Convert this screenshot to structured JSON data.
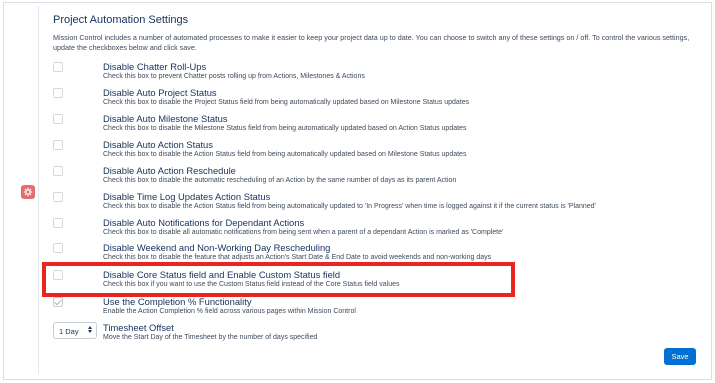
{
  "panel": {
    "title": "Project Automation Settings",
    "intro": "Mission Control includes a number of automated processes to make it easier to keep your project data up to date. You can choose to switch any of these settings on / off. To control the various settings, update the checkboxes below and click save."
  },
  "settings": [
    {
      "label": "Disable Chatter Roll-Ups",
      "desc": "Check this box to prevent Chatter posts rolling up from Actions, Milestones & Actions",
      "checked": false
    },
    {
      "label": "Disable Auto Project Status",
      "desc": "Check this box to disable the Project Status field from being automatically updated based on Milestone Status updates",
      "checked": false
    },
    {
      "label": "Disable Auto Milestone Status",
      "desc": "Check this box to disable the Milestone Status field from being automatically updated based on Action Status updates",
      "checked": false
    },
    {
      "label": "Disable Auto Action Status",
      "desc": "Check this box to disable the Action Status field from being automatically updated based on Milestone Status updates",
      "checked": false
    },
    {
      "label": "Disable Auto Action Reschedule",
      "desc": "Check this box to disable the automatic rescheduling of an Action by the same number of days as its parent Action",
      "checked": false
    },
    {
      "label": "Disable Time Log Updates Action Status",
      "desc": "Check this box to disable the Action Status field from being automatically updated to 'In Progress' when time is logged against it if the current status is 'Planned'",
      "checked": false
    },
    {
      "label": "Disable Auto Notifications for Dependant Actions",
      "desc": "Check this box to disable all automatic notifications from being sent when a parent of a dependant Action is marked as 'Complete'",
      "checked": false
    },
    {
      "label": "Disable Weekend and Non-Working Day Rescheduling",
      "desc": "Check this box to disable the feature that adjusts an Action's Start Date & End Date to avoid weekends and non-working days",
      "checked": false
    },
    {
      "label": "Disable Core Status field and Enable Custom Status field",
      "desc": "Check this box if you want to use the Custom Status field instead of the Core Status field values",
      "checked": false
    },
    {
      "label": "Use the Completion % Functionality",
      "desc": "Enable the Action Completion % field across various pages within Mission Control",
      "checked": true
    }
  ],
  "timesheet": {
    "selected": "1 Day",
    "label": "Timesheet Offset",
    "desc": "Move the Start Day of the Timesheet by the number of days specified"
  },
  "save_label": "Save",
  "colors": {
    "accent": "#0070d2",
    "highlight": "#e8251f",
    "badge": "#e26e6e"
  },
  "icons": {
    "badge": "gear-icon"
  }
}
